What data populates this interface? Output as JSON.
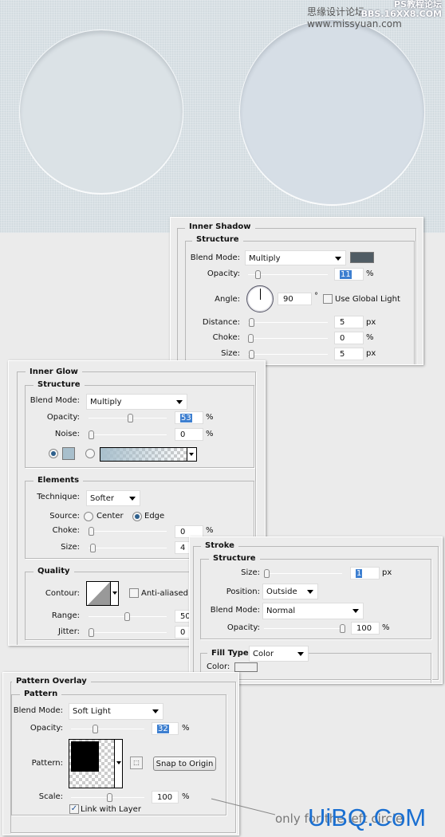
{
  "watermarks": {
    "top_left": "思缘设计论坛 www.missyuan.com",
    "top_right_line1": "PS教程论坛",
    "top_right_line2": "BBS.16XX8.COM",
    "bottom": "UiBQ.CoM"
  },
  "colors": {
    "inner_shadow_color": "#505c64",
    "inner_glow_color": "#a8bfcc",
    "watermark_blue": "#1a6fd1"
  },
  "inner_shadow": {
    "title": "Inner Shadow",
    "structure": "Structure",
    "blend_mode_label": "Blend Mode:",
    "blend_mode": "Multiply",
    "opacity_label": "Opacity:",
    "opacity": "11",
    "opacity_unit": "%",
    "opacity_pct": 11,
    "angle_label": "Angle:",
    "angle": "90",
    "degree": "°",
    "use_global_light": "Use Global Light",
    "use_global_light_checked": false,
    "distance_label": "Distance:",
    "distance": "5",
    "distance_unit": "px",
    "choke_label": "Choke:",
    "choke": "0",
    "choke_unit": "%",
    "size_label": "Size:",
    "size": "5",
    "size_unit": "px"
  },
  "inner_glow": {
    "title": "Inner Glow",
    "structure": "Structure",
    "blend_mode_label": "Blend Mode:",
    "blend_mode": "Multiply",
    "opacity_label": "Opacity:",
    "opacity": "53",
    "opacity_unit": "%",
    "noise_label": "Noise:",
    "noise": "0",
    "noise_unit": "%",
    "elements": "Elements",
    "technique_label": "Technique:",
    "technique": "Softer",
    "source_label": "Source:",
    "source_center": "Center",
    "source_edge": "Edge",
    "source_selected": "Edge",
    "choke_label": "Choke:",
    "choke": "0",
    "choke_unit": "%",
    "size_label": "Size:",
    "size": "4",
    "quality": "Quality",
    "contour_label": "Contour:",
    "anti_aliased": "Anti-aliased",
    "anti_aliased_checked": false,
    "range_label": "Range:",
    "range": "50",
    "jitter_label": "Jitter:",
    "jitter": "0"
  },
  "stroke": {
    "title": "Stroke",
    "structure": "Structure",
    "size_label": "Size:",
    "size": "1",
    "size_unit": "px",
    "position_label": "Position:",
    "position": "Outside",
    "blend_mode_label": "Blend Mode:",
    "blend_mode": "Normal",
    "opacity_label": "Opacity:",
    "opacity": "100",
    "opacity_unit": "%",
    "fill_type_label": "Fill Type:",
    "fill_type": "Color",
    "color_label": "Color:"
  },
  "pattern_overlay": {
    "title": "Pattern Overlay",
    "pattern_group": "Pattern",
    "blend_mode_label": "Blend Mode:",
    "blend_mode": "Soft Light",
    "opacity_label": "Opacity:",
    "opacity": "32",
    "opacity_unit": "%",
    "pattern_label": "Pattern:",
    "snap_to_origin": "Snap to Origin",
    "scale_label": "Scale:",
    "scale": "100",
    "scale_unit": "%",
    "link_with_layer": "Link with Layer",
    "link_with_layer_checked": true
  },
  "annotation": "only for the left circle"
}
